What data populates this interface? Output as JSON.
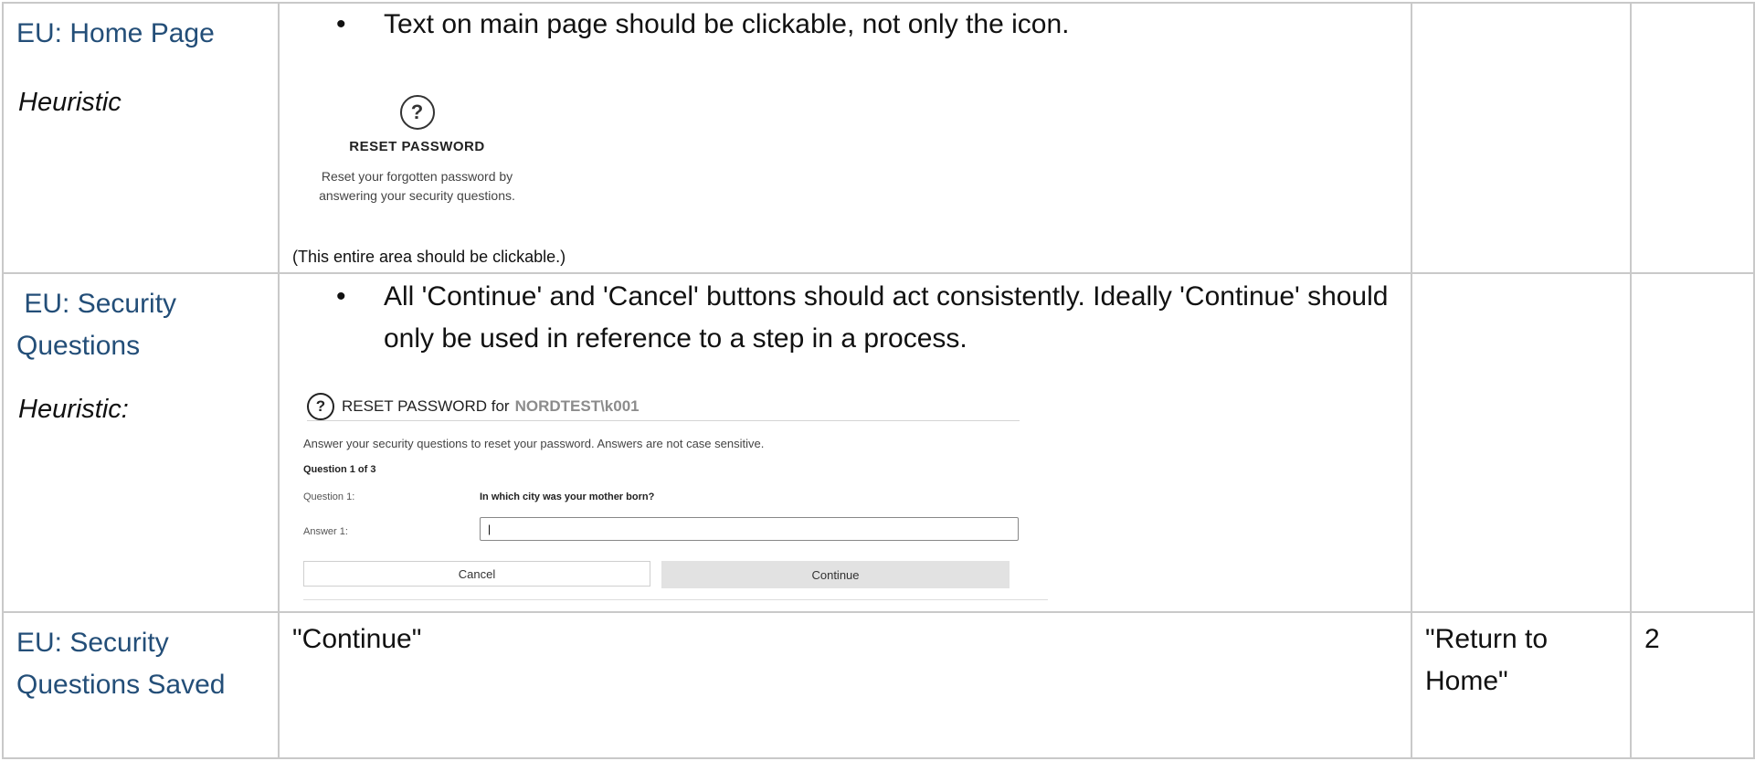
{
  "rows": [
    {
      "section": "EU: Home Page",
      "heuristic": "Heuristic",
      "bullet": "Text on main page should be clickable, not only the icon.",
      "card": {
        "icon": "?",
        "heading": "RESET PASSWORD",
        "description": "Reset your forgotten password by answering your security questions."
      },
      "note": "(This entire area should be clickable.)",
      "col3": "",
      "col4": ""
    },
    {
      "section": " EU: Security Questions",
      "heuristic": "Heuristic:",
      "bullet": "All 'Continue' and 'Cancel' buttons should act consistently. Ideally 'Continue' should only be used in reference to a step in a process.",
      "form": {
        "icon": "?",
        "title": "RESET PASSWORD for",
        "username": "NORDTEST\\k001",
        "instructions": "Answer your security questions to reset your password. Answers are not case sensitive.",
        "progress": "Question 1 of 3",
        "question_label": "Question 1:",
        "question_text": "In which city was your mother born?",
        "answer_label": "Answer 1:",
        "answer_value": "|",
        "cancel_label": "Cancel",
        "continue_label": "Continue"
      },
      "col3": "",
      "col4": ""
    },
    {
      "section": "EU: Security Questions Saved",
      "text": "\"Continue\"",
      "col3": "\"Return to Home\"",
      "col4": "2"
    }
  ]
}
